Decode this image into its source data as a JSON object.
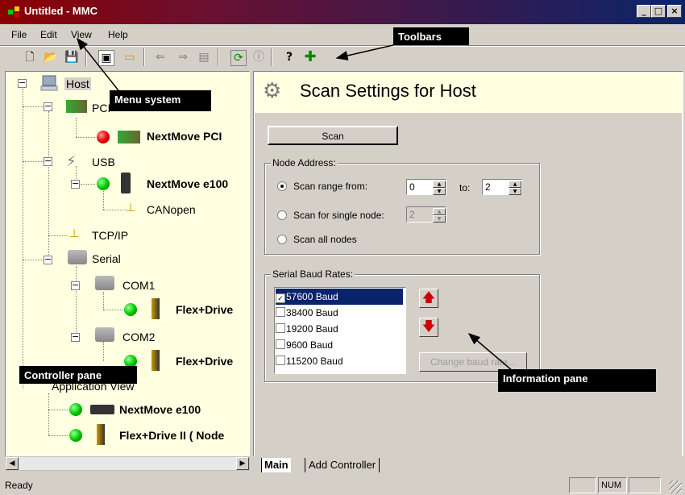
{
  "window": {
    "title": "Untitled - MMC",
    "min": "_",
    "max": "□",
    "close": "×"
  },
  "menu": [
    {
      "label": "File"
    },
    {
      "label": "Edit"
    },
    {
      "label": "View"
    },
    {
      "label": "Help"
    }
  ],
  "tree": {
    "host": "Host",
    "pci": "PCI",
    "pci_device": "NextMove PCI",
    "usb": "USB",
    "usb_device": "NextMove e100",
    "canopen": "CANopen",
    "tcpip": "TCP/IP",
    "serial": "Serial",
    "com1": "COM1",
    "com1_device": "Flex+Drive",
    "com2": "COM2",
    "com2_device": "Flex+Drive",
    "appview": "Application View",
    "app_dev1": "NextMove e100",
    "app_dev2": "Flex+Drive II ( Node"
  },
  "info": {
    "title": "Scan Settings for Host",
    "scan_button": "Scan",
    "node_group": "Node Address:",
    "opt_range": "Scan range from:",
    "range_from": "0",
    "range_to_label": "to:",
    "range_to": "2",
    "opt_single": "Scan for single node:",
    "single_value": "2",
    "opt_all": "Scan all nodes",
    "baud_group": "Serial Baud Rates:",
    "baud_rates": [
      {
        "label": "57600 Baud",
        "checked": true
      },
      {
        "label": "38400 Baud",
        "checked": false
      },
      {
        "label": "19200 Baud",
        "checked": false
      },
      {
        "label": "9600 Baud",
        "checked": false
      },
      {
        "label": "115200 Baud",
        "checked": false
      }
    ],
    "change_baud": "Change baud rate..."
  },
  "tabs": [
    {
      "label": "Main"
    },
    {
      "label": "Add Controller"
    }
  ],
  "status": {
    "text": "Ready",
    "num": "NUM"
  },
  "callouts": {
    "toolbars": "Toolbars",
    "menu_system": "Menu system",
    "controller_pane": "Controller pane",
    "information_pane": "Information pane"
  },
  "colors": {
    "tree_bg": "#ffffe1",
    "selection": "#0a246a",
    "title_start": "#8b0000",
    "title_end": "#0a246a"
  }
}
